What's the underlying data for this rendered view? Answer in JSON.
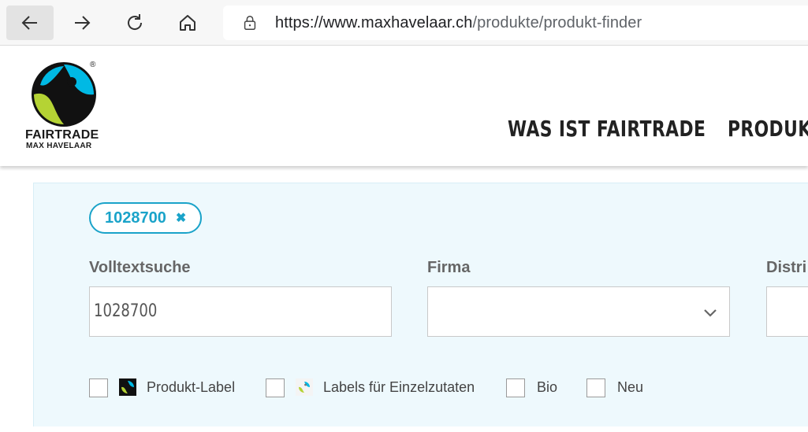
{
  "browser": {
    "url_domain": "https://www.maxhavelaar.ch",
    "url_path": "/produkte/produkt-finder"
  },
  "header": {
    "logo_word": "FAIRTRADE",
    "logo_sub": "MAX HAVELAAR",
    "logo_reg": "®",
    "menu": [
      "WAS IST FAIRTRADE",
      "PRODUKT"
    ]
  },
  "filter": {
    "active_chip": "1028700",
    "chip_remove": "✖",
    "fields": {
      "fulltext_label": "Volltextsuche",
      "fulltext_value": "1028700",
      "company_label": "Firma",
      "company_value": "",
      "distributor_label": "Distri"
    },
    "checkboxes": [
      {
        "label": "Produkt-Label",
        "checked": false,
        "icon": "fairtrade-mark-icon"
      },
      {
        "label": "Labels für Einzelzutaten",
        "checked": false,
        "icon": "ingredient-label-icon"
      },
      {
        "label": "Bio",
        "checked": false
      },
      {
        "label": "Neu",
        "checked": false
      }
    ]
  },
  "colors": {
    "accent": "#1aa3c9",
    "panel_bg": "#eef9fd",
    "logo_blue": "#00b9e4",
    "logo_green": "#b5d334"
  }
}
